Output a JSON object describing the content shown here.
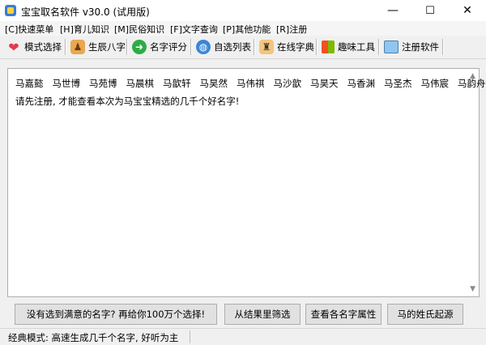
{
  "window": {
    "title": "宝宝取名软件 v30.0 (试用版)",
    "minimize": "—",
    "maximize": "☐",
    "close": "✕"
  },
  "menu": [
    "[C]快速菜单",
    "[H]育儿知识",
    "[M]民俗知识",
    "[F]文字查询",
    "[P]其他功能",
    "[R]注册"
  ],
  "toolbar": [
    {
      "label": "模式选择",
      "icon": "heart-icon"
    },
    {
      "label": "生辰八字",
      "icon": "people-icon"
    },
    {
      "label": "名字评分",
      "icon": "arrow-circle-icon"
    },
    {
      "label": "自选列表",
      "icon": "globe-icon"
    },
    {
      "label": "在线字典",
      "icon": "graduate-icon"
    },
    {
      "label": "趣味工具",
      "icon": "windows-logo-icon"
    },
    {
      "label": "注册软件",
      "icon": "monitor-icon"
    }
  ],
  "names": [
    "马嘉懿",
    "马世博",
    "马苑博",
    "马晨棋",
    "马歆轩",
    "马昊然",
    "马伟祺",
    "马沙歆",
    "马昊天",
    "马香渊",
    "马圣杰",
    "马伟宸",
    "马韵舟....."
  ],
  "notice": "请先注册, 才能查看本次为马宝宝精选的几千个好名字!",
  "buttons": [
    "没有选到满意的名字? 再给你100万个选择!",
    "从结果里筛选",
    "查看各名字属性",
    "马的姓氏起源"
  ],
  "status": "经典模式: 高速生成几千个名字, 好听为主"
}
